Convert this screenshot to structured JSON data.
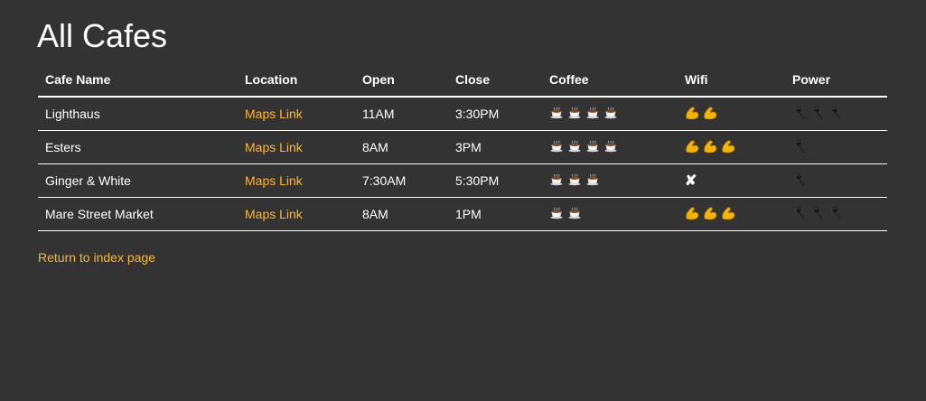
{
  "page": {
    "title": "All Cafes",
    "return_link": "Return to index page"
  },
  "table": {
    "headers": [
      "Cafe Name",
      "Location",
      "Open",
      "Close",
      "Coffee",
      "Wifi",
      "Power"
    ],
    "rows": [
      {
        "name": "Lighthaus",
        "location": "Maps Link",
        "open": "11AM",
        "close": "3:30PM",
        "coffee": 4,
        "wifi": 2,
        "power": 3
      },
      {
        "name": "Esters",
        "location": "Maps Link",
        "open": "8AM",
        "close": "3PM",
        "coffee": 4,
        "wifi": 3,
        "power": 1
      },
      {
        "name": "Ginger & White",
        "location": "Maps Link",
        "open": "7:30AM",
        "close": "5:30PM",
        "coffee": 3,
        "wifi": 0,
        "power": 1
      },
      {
        "name": "Mare Street Market",
        "location": "Maps Link",
        "open": "8AM",
        "close": "1PM",
        "coffee": 2,
        "wifi": 3,
        "power": 3
      }
    ],
    "zero_wifi_glyph": "✘"
  },
  "icons": {
    "coffee": "coffee-cup-icon",
    "wifi": "flexed-bicep-icon",
    "power": "plug-icon"
  },
  "colors": {
    "background": "#333333",
    "text": "#ffffff",
    "link": "#ffb62e"
  }
}
